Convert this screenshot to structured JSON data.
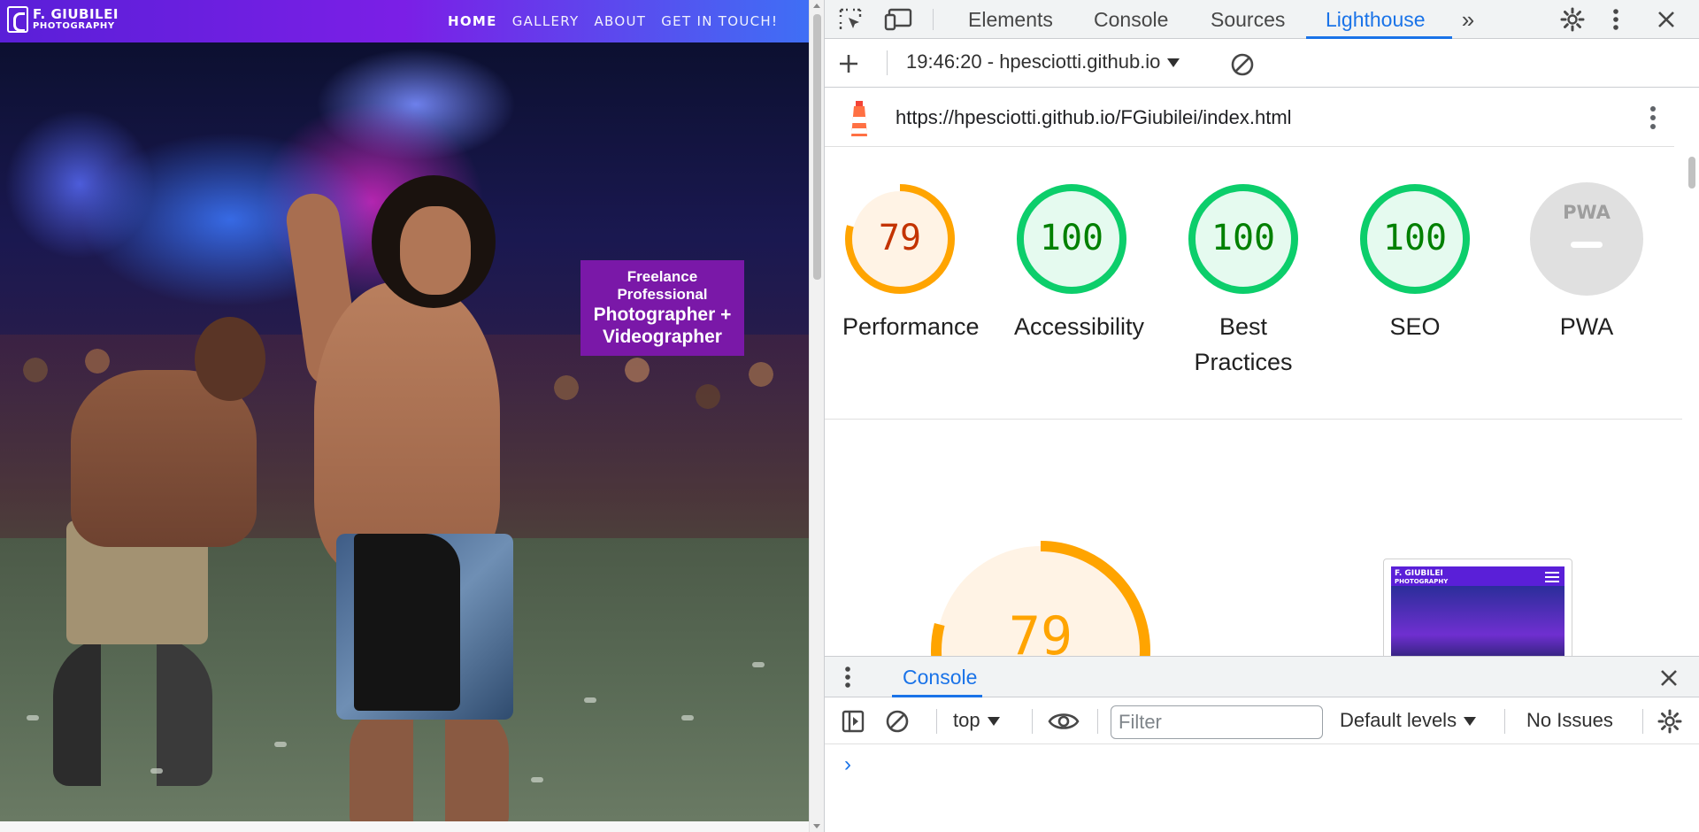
{
  "site": {
    "logo": {
      "line1": "F. GIUBILEI",
      "line2": "PHOTOGRAPHY"
    },
    "nav": [
      {
        "label": "HOME",
        "active": true
      },
      {
        "label": "GALLERY",
        "active": false
      },
      {
        "label": "ABOUT",
        "active": false
      },
      {
        "label": "GET IN TOUCH!",
        "active": false
      }
    ],
    "badge": {
      "line1": "Freelance",
      "line2": "Professional",
      "line3": "Photographer +",
      "line4": "Videographer"
    }
  },
  "devtools": {
    "tabs": [
      "Elements",
      "Console",
      "Sources",
      "Lighthouse"
    ],
    "active_tab": "Lighthouse",
    "more_tabs_icon": "chevron-double-right-icon",
    "report_select": "19:46:20 - hpesciotti.github.io",
    "url": "https://hpesciotti.github.io/FGiubilei/index.html",
    "scores": [
      {
        "label": "Performance",
        "value": "79",
        "color": "#ffa400",
        "text_color": "#c33300",
        "fill": "#fff3e5",
        "fraction": 0.79
      },
      {
        "label": "Accessibility",
        "value": "100",
        "color": "#0cce6b",
        "text_color": "#008000",
        "fill": "#e5faef",
        "fraction": 1
      },
      {
        "label": "Best Practices",
        "value": "100",
        "color": "#0cce6b",
        "text_color": "#008000",
        "fill": "#e5faef",
        "fraction": 1
      },
      {
        "label": "SEO",
        "value": "100",
        "color": "#0cce6b",
        "text_color": "#008000",
        "fill": "#e5faef",
        "fraction": 1
      },
      {
        "label": "PWA",
        "value": "PWA",
        "color": "#e0e0e0",
        "text_color": "#9e9e9e",
        "fill": "#e0e0e0",
        "fraction": 0
      }
    ],
    "big_score": {
      "value": "79",
      "color": "#ffa400",
      "fill": "#fff3e5"
    },
    "thumbnail": {
      "logo_line1": "F. GIUBILEI",
      "logo_line2": "PHOTOGRAPHY"
    },
    "drawer": {
      "tab": "Console",
      "context": "top",
      "filter_placeholder": "Filter",
      "levels": "Default levels",
      "issues": "No Issues",
      "prompt": "›"
    }
  }
}
